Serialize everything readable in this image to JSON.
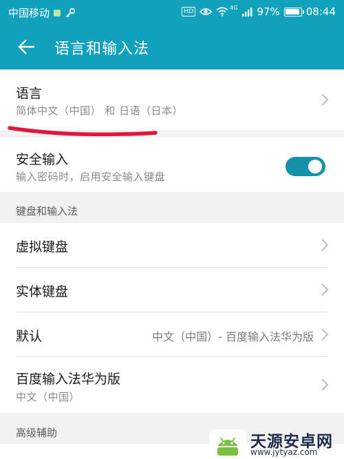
{
  "status_bar": {
    "carrier": "中国移动",
    "hd": "HD",
    "network": "4G",
    "battery": "97%",
    "battery_level": 0.97,
    "time": "08:44"
  },
  "header": {
    "title": "语言和输入法"
  },
  "language": {
    "title": "语言",
    "value": "简体中文（中国） 和 日语（日本）"
  },
  "secure_input": {
    "title": "安全输入",
    "desc": "输入密码时，启用安全输入键盘",
    "enabled": true
  },
  "section_keyboards": "键盘和输入法",
  "virtual_keyboard": "虚拟键盘",
  "physical_keyboard": "实体键盘",
  "default": {
    "title": "默认",
    "value": "中文（中国）- 百度输入法华为版"
  },
  "baidu": {
    "title": "百度输入法华为版",
    "sub": "中文（中国）"
  },
  "section_advanced": "高级辅助",
  "watermark": {
    "name": "天源安卓网",
    "url": "www.jytyaz.com"
  },
  "colors": {
    "primary": "#12a1bd",
    "toggle": "#1591ac",
    "annotation": "#e0173a"
  }
}
